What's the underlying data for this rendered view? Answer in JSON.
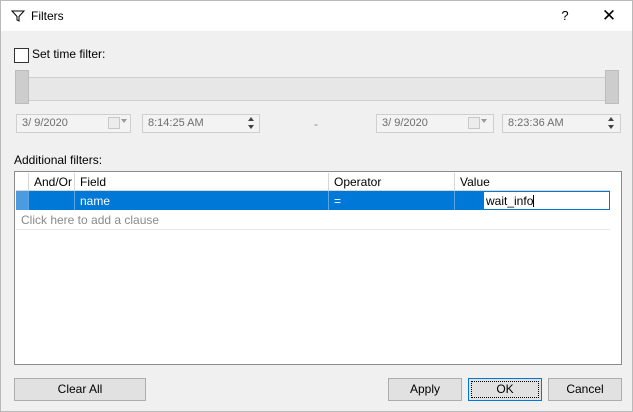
{
  "window": {
    "title": "Filters",
    "help": "?",
    "close": "✕"
  },
  "time_filter": {
    "label": "Set time filter:",
    "checked": false,
    "range_start_fraction": 0.0,
    "range_end_fraction": 1.0,
    "start_date": "3/  9/2020",
    "start_time": "8:14:25 AM",
    "separator": "-",
    "end_date": "3/  9/2020",
    "end_time": "8:23:36 AM"
  },
  "additional": {
    "label": "Additional filters:",
    "columns": [
      "And/Or",
      "Field",
      "Operator",
      "Value"
    ],
    "row": {
      "and_or": "",
      "field": "name",
      "operator": "=",
      "value": "wait_info"
    },
    "add_clause": "Click here to add a clause"
  },
  "buttons": {
    "clear_all": "Clear All",
    "apply": "Apply",
    "ok": "OK",
    "cancel": "Cancel"
  },
  "colors": {
    "selection": "#0078d7",
    "background": "#f0f0f0"
  },
  "icons": {
    "title": "filter-icon"
  }
}
